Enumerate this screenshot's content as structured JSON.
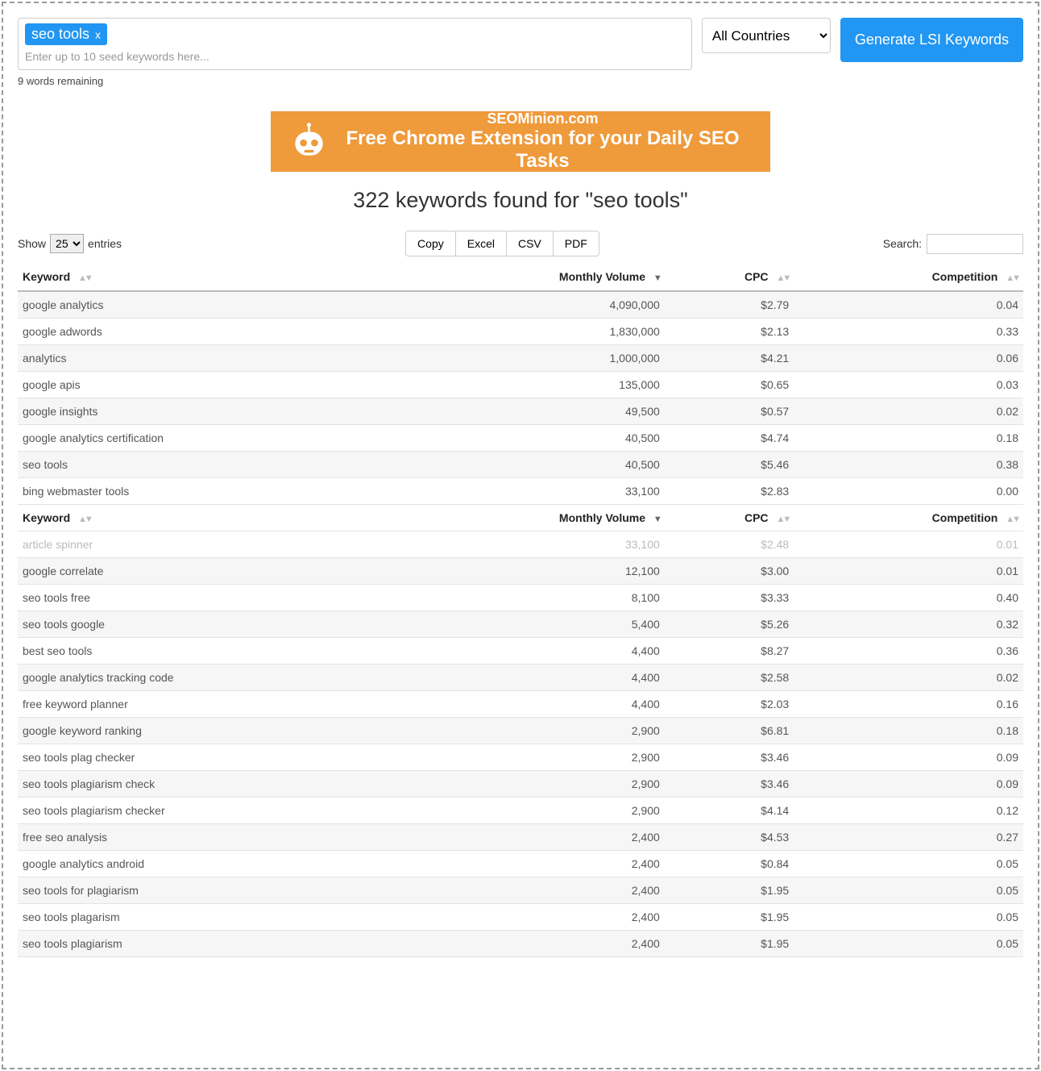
{
  "seed": {
    "chip_label": "seo tools",
    "chip_close": "x",
    "placeholder": "Enter up to 10 seed keywords here...",
    "remaining": "9 words remaining"
  },
  "country": {
    "selected": "All Countries"
  },
  "generate_btn": "Generate LSI Keywords",
  "banner": {
    "line1": "SEOMinion.com",
    "line2": "Free Chrome Extension for your Daily SEO Tasks"
  },
  "results_heading": "322 keywords found for \"seo tools\"",
  "show": {
    "label_pre": "Show",
    "value": "25",
    "label_post": "entries"
  },
  "export": {
    "copy": "Copy",
    "excel": "Excel",
    "csv": "CSV",
    "pdf": "PDF"
  },
  "search": {
    "label": "Search:",
    "value": ""
  },
  "columns": {
    "keyword": "Keyword",
    "volume": "Monthly Volume",
    "cpc": "CPC",
    "competition": "Competition"
  },
  "rows_top": [
    {
      "k": "google analytics",
      "v": "4,090,000",
      "c": "$2.79",
      "p": "0.04"
    },
    {
      "k": "google adwords",
      "v": "1,830,000",
      "c": "$2.13",
      "p": "0.33"
    },
    {
      "k": "analytics",
      "v": "1,000,000",
      "c": "$4.21",
      "p": "0.06"
    },
    {
      "k": "google apis",
      "v": "135,000",
      "c": "$0.65",
      "p": "0.03"
    },
    {
      "k": "google insights",
      "v": "49,500",
      "c": "$0.57",
      "p": "0.02"
    },
    {
      "k": "google analytics certification",
      "v": "40,500",
      "c": "$4.74",
      "p": "0.18"
    },
    {
      "k": "seo tools",
      "v": "40,500",
      "c": "$5.46",
      "p": "0.38"
    },
    {
      "k": "bing webmaster tools",
      "v": "33,100",
      "c": "$2.83",
      "p": "0.00"
    }
  ],
  "row_cut": {
    "k": "article spinner",
    "v": "33,100",
    "c": "$2.48",
    "p": "0.01"
  },
  "rows_bottom": [
    {
      "k": "google correlate",
      "v": "12,100",
      "c": "$3.00",
      "p": "0.01"
    },
    {
      "k": "seo tools free",
      "v": "8,100",
      "c": "$3.33",
      "p": "0.40"
    },
    {
      "k": "seo tools google",
      "v": "5,400",
      "c": "$5.26",
      "p": "0.32"
    },
    {
      "k": "best seo tools",
      "v": "4,400",
      "c": "$8.27",
      "p": "0.36"
    },
    {
      "k": "google analytics tracking code",
      "v": "4,400",
      "c": "$2.58",
      "p": "0.02"
    },
    {
      "k": "free keyword planner",
      "v": "4,400",
      "c": "$2.03",
      "p": "0.16"
    },
    {
      "k": "google keyword ranking",
      "v": "2,900",
      "c": "$6.81",
      "p": "0.18"
    },
    {
      "k": "seo tools plag checker",
      "v": "2,900",
      "c": "$3.46",
      "p": "0.09"
    },
    {
      "k": "seo tools plagiarism check",
      "v": "2,900",
      "c": "$3.46",
      "p": "0.09"
    },
    {
      "k": "seo tools plagiarism checker",
      "v": "2,900",
      "c": "$4.14",
      "p": "0.12"
    },
    {
      "k": "free seo analysis",
      "v": "2,400",
      "c": "$4.53",
      "p": "0.27"
    },
    {
      "k": "google analytics android",
      "v": "2,400",
      "c": "$0.84",
      "p": "0.05"
    },
    {
      "k": "seo tools for plagiarism",
      "v": "2,400",
      "c": "$1.95",
      "p": "0.05"
    },
    {
      "k": "seo tools plagarism",
      "v": "2,400",
      "c": "$1.95",
      "p": "0.05"
    },
    {
      "k": "seo tools plagiarism",
      "v": "2,400",
      "c": "$1.95",
      "p": "0.05"
    }
  ]
}
